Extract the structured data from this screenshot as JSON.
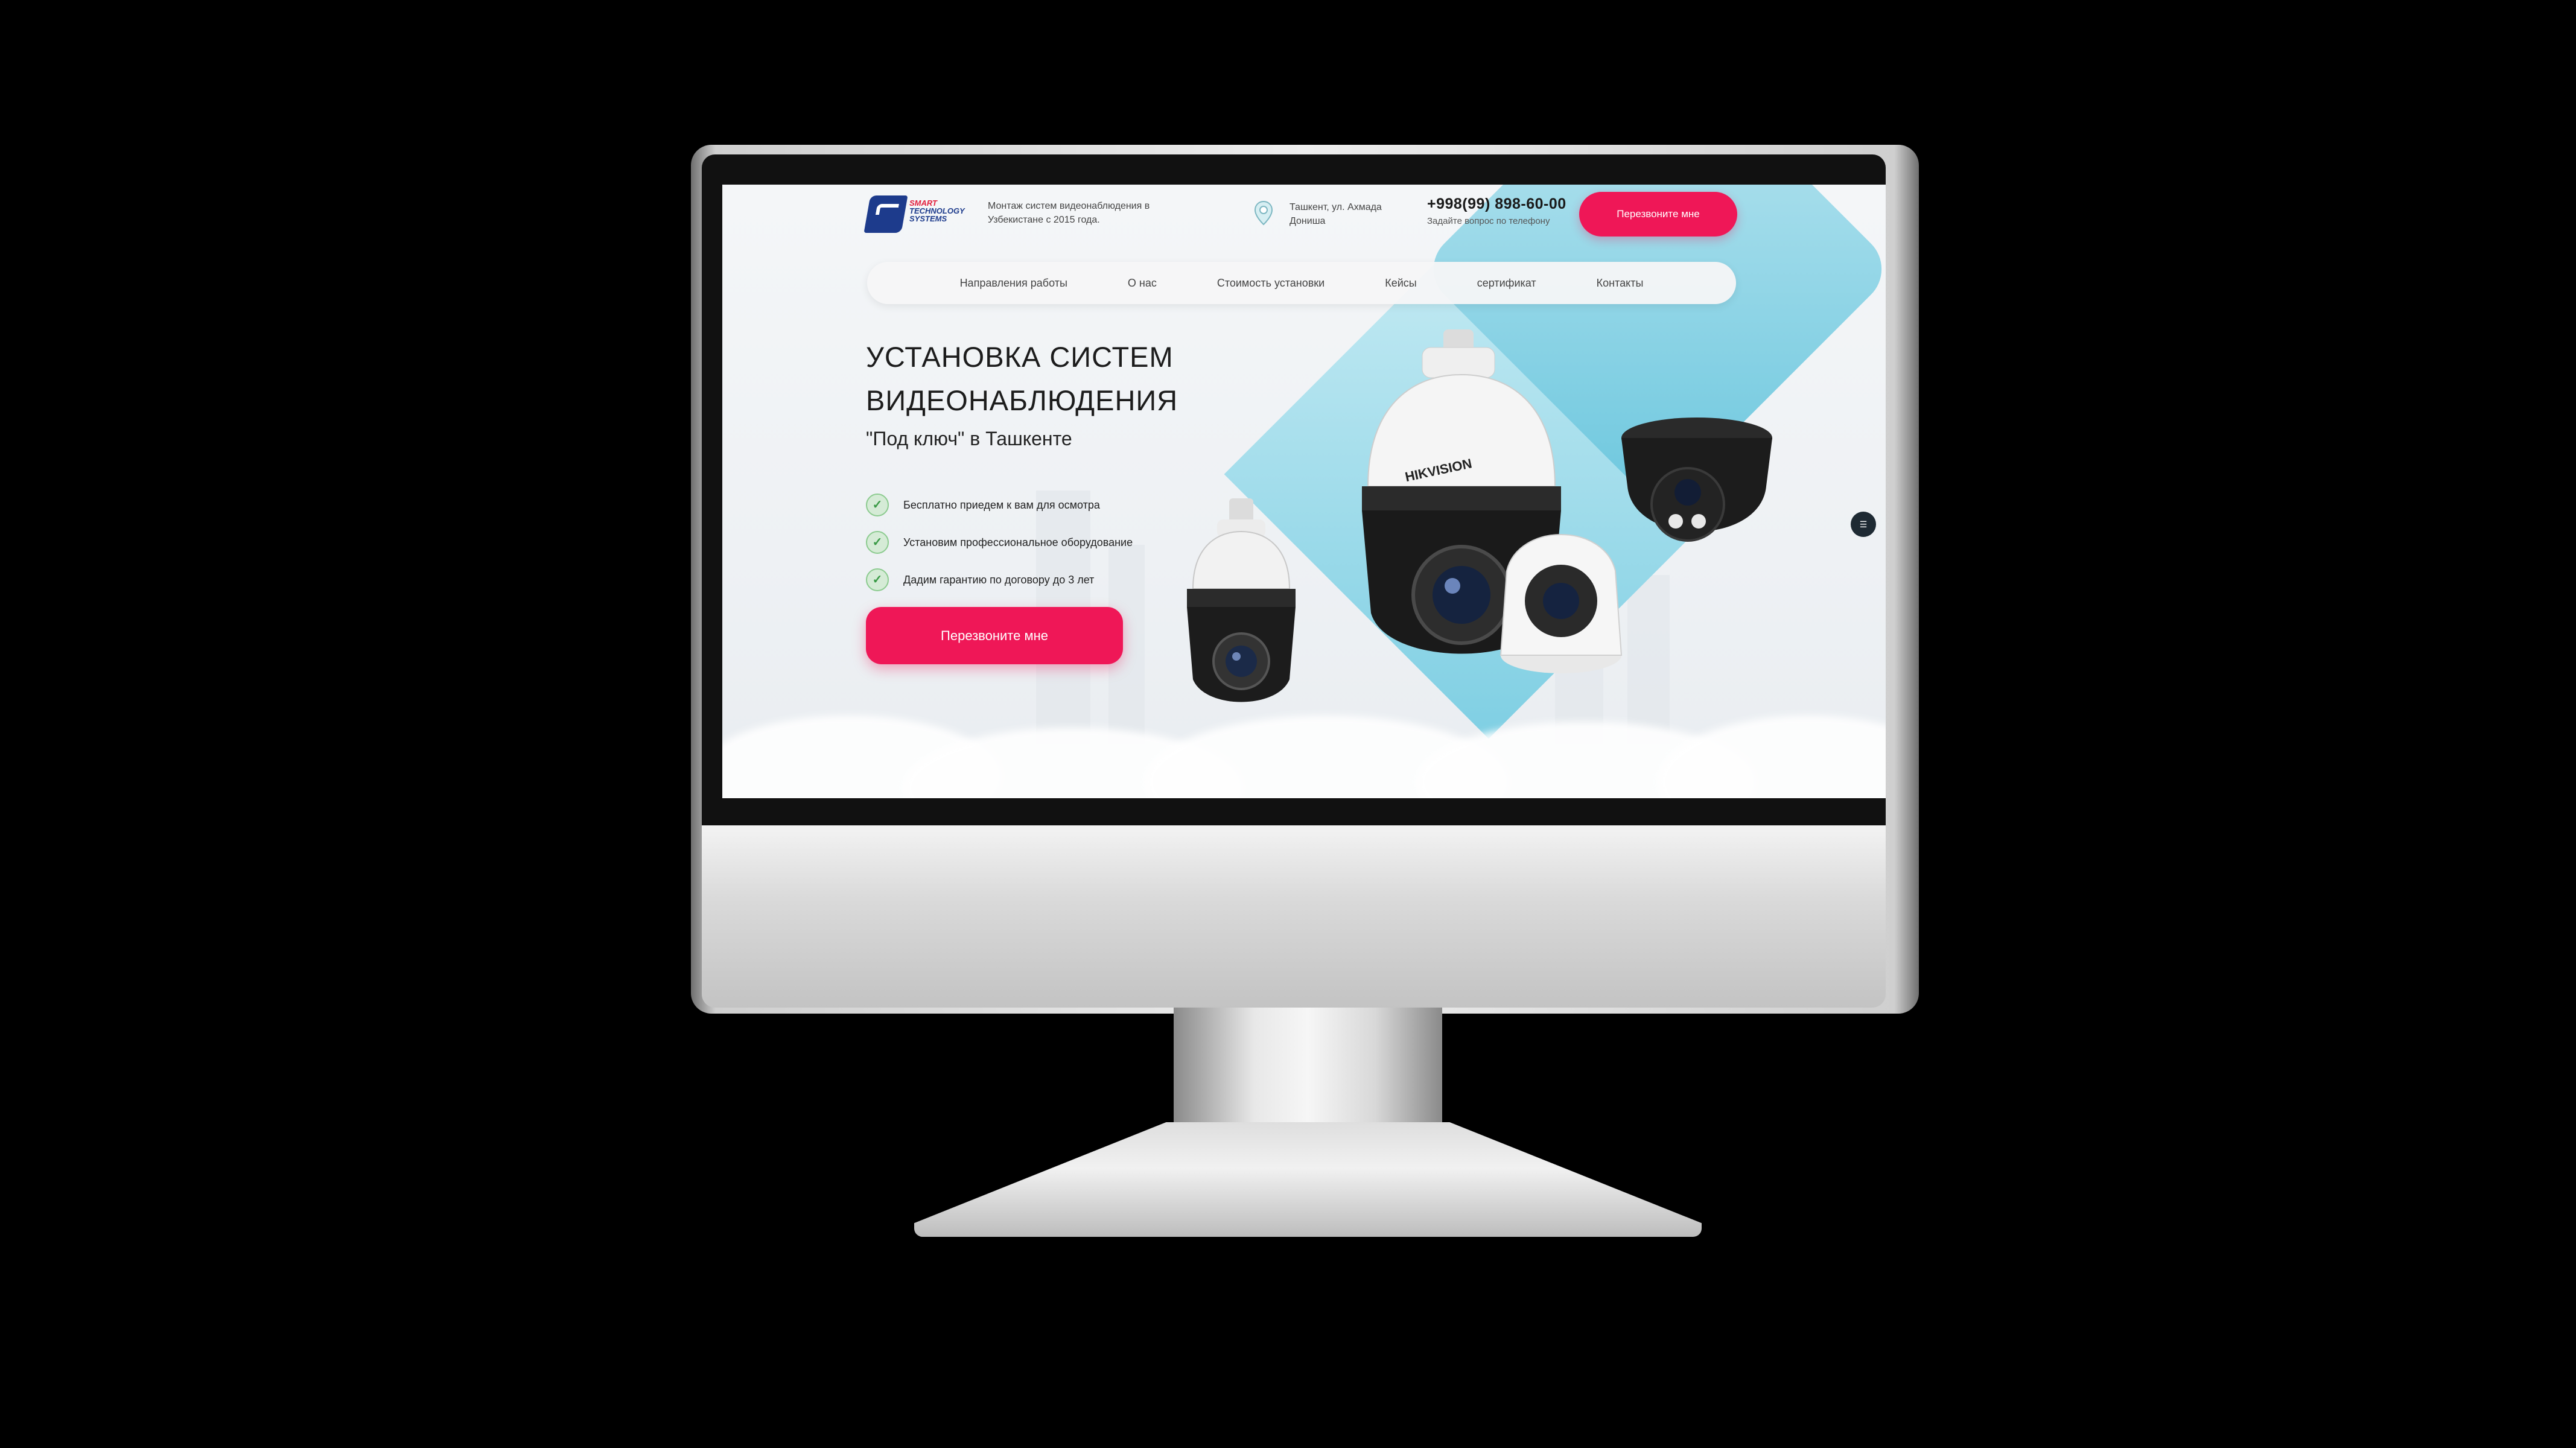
{
  "brand": {
    "logo_lines": [
      "SMART",
      "TECHNOLOGY",
      "SYSTEMS"
    ],
    "tagline": "Монтаж систем видеонаблюдения в Узбекистане с 2015 года."
  },
  "contact": {
    "address": "Ташкент, ул. Ахмада Донишa",
    "phone": "+998(99) 898-60-00",
    "phone_caption": "Задайте вопрос по телефону",
    "callback_label": "Перезвоните мне"
  },
  "nav": {
    "items": [
      {
        "label": "Направления работы"
      },
      {
        "label": "О нас"
      },
      {
        "label": "Стоимость установки"
      },
      {
        "label": "Кейсы"
      },
      {
        "label": "сертификат"
      },
      {
        "label": "Контакты"
      }
    ]
  },
  "hero": {
    "title_line1": "УСТАНОВКА СИСТЕМ",
    "title_line2": "ВИДЕОНАБЛЮДЕНИЯ",
    "subtitle": "\"Под ключ\" в Ташкенте",
    "bullets": [
      {
        "text": "Бесплатно приедем к вам для осмотра"
      },
      {
        "text": "Установим профессиональное оборудование"
      },
      {
        "text": "Дадим гарантию по договору до 3 лет"
      }
    ],
    "cta_label": "Перезвоните мне",
    "camera_brand": "HIKVISION"
  },
  "colors": {
    "accent": "#ef1757",
    "brand_blue": "#1d3b8c",
    "brand_red": "#e31e3c",
    "diamond": "#6cc7de",
    "check_green": "#3a9a46"
  },
  "icons": {
    "location": "location-pin-icon",
    "check": "check-circle-icon",
    "side": "menu-icon"
  }
}
